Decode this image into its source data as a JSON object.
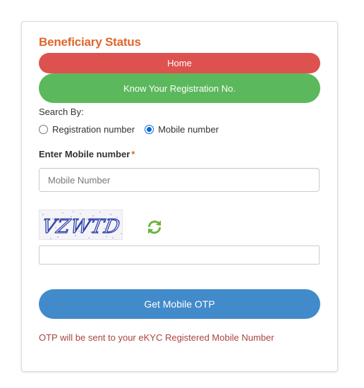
{
  "panel": {
    "title": "Beneficiary Status",
    "home_button": "Home",
    "register_button": "Know Your Registration No.",
    "search_by_label": "Search By:",
    "radio_options": [
      {
        "label": "Registration number",
        "checked": false
      },
      {
        "label": "Mobile number",
        "checked": true
      }
    ],
    "mobile_label": "Enter Mobile number",
    "required_marker": "*",
    "mobile_input": {
      "placeholder": "Mobile Number",
      "value": ""
    },
    "captcha": {
      "text": "VZWTD",
      "alt": "captcha image"
    },
    "captcha_input": {
      "value": "",
      "placeholder": ""
    },
    "otp_button": "Get Mobile OTP",
    "note": "OTP will be sent to your eKYC Registered Mobile Number"
  },
  "colors": {
    "title": "#e0662d",
    "home_button": "#dd524f",
    "register_button": "#5cb85c",
    "otp_button": "#428bca",
    "note": "#a94442",
    "refresh_icon": "#6bb33e",
    "captcha_text": "#2c3fa8"
  },
  "icons": {
    "refresh": "refresh-icon"
  }
}
